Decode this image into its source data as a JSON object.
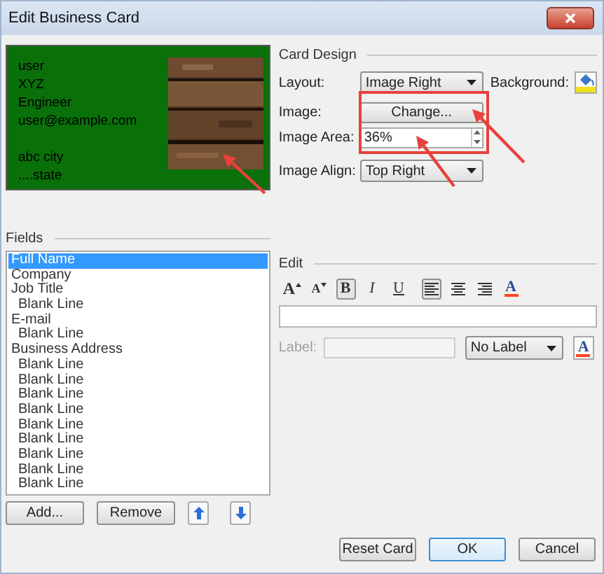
{
  "window": {
    "title": "Edit Business Card"
  },
  "card_preview": {
    "blocks": [
      [
        "user",
        "XYZ",
        "Engineer",
        "user@example.com"
      ],
      [
        "abc city",
        "....state"
      ]
    ],
    "image": {
      "kind": "picture"
    }
  },
  "card_design": {
    "heading": "Card Design",
    "layout": {
      "label": "Layout:",
      "value": "Image Right"
    },
    "background": {
      "label": "Background:"
    },
    "image": {
      "label": "Image:",
      "button": "Change..."
    },
    "image_area": {
      "label": "Image Area:",
      "value": "36%"
    },
    "image_align": {
      "label": "Image Align:",
      "value": "Top Right"
    }
  },
  "fields": {
    "heading": "Fields",
    "items": [
      {
        "label": "Full Name",
        "selected": true
      },
      {
        "label": "Company",
        "selected": false
      },
      {
        "label": "Job Title",
        "selected": false,
        "children": [
          {
            "label": "Blank Line",
            "selected": false
          }
        ]
      },
      {
        "label": "E-mail",
        "selected": false,
        "children": [
          {
            "label": "Blank Line",
            "selected": false
          }
        ]
      },
      {
        "label": "Business Address",
        "selected": false,
        "children": [
          {
            "label": "Blank Line",
            "selected": false
          },
          {
            "label": "Blank Line",
            "selected": false
          },
          {
            "label": "Blank Line",
            "selected": false
          },
          {
            "label": "Blank Line",
            "selected": false
          },
          {
            "label": "Blank Line",
            "selected": false
          },
          {
            "label": "Blank Line",
            "selected": false
          },
          {
            "label": "Blank Line",
            "selected": false
          },
          {
            "label": "Blank Line",
            "selected": false
          },
          {
            "label": "Blank Line",
            "selected": false
          }
        ]
      }
    ],
    "buttons": [
      "Add...",
      "Remove"
    ]
  },
  "edit": {
    "heading": "Edit",
    "toolbar": [
      {
        "kind": "grow",
        "label": "A"
      },
      {
        "kind": "shrink",
        "label": "A"
      },
      {
        "kind": "bold",
        "label": "B",
        "selected": true
      },
      {
        "kind": "italic",
        "label": "I",
        "selected": false
      },
      {
        "kind": "underline",
        "label": "U",
        "selected": false
      },
      {
        "kind": "align-left",
        "selected": true
      },
      {
        "kind": "align-center",
        "selected": false
      },
      {
        "kind": "align-right",
        "selected": false
      },
      {
        "kind": "color",
        "label": "A"
      }
    ],
    "label": {
      "text": "Label:",
      "disabled": true
    },
    "label_dropdown": "No Label",
    "label_color_button": {
      "label": "A"
    }
  },
  "buttons": [
    {
      "label": "Reset Card",
      "default": false
    },
    {
      "label": "OK",
      "default": true
    },
    {
      "label": "Cancel",
      "default": false
    }
  ]
}
